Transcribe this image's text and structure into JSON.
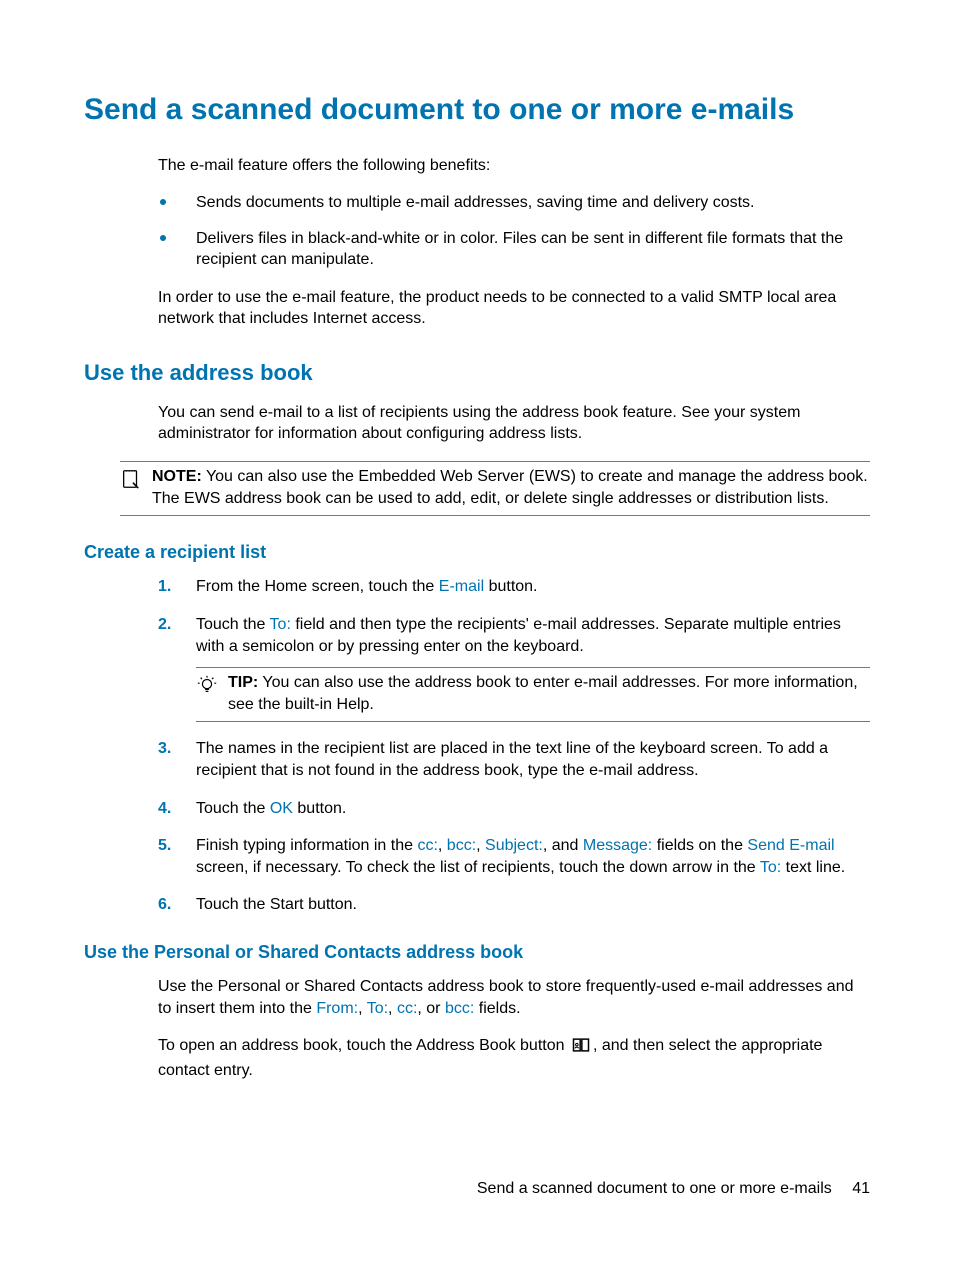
{
  "title": "Send a scanned document to one or more e-mails",
  "intro": "The e-mail feature offers the following benefits:",
  "bullets": [
    "Sends documents to multiple e-mail addresses, saving time and delivery costs.",
    "Delivers files in black-and-white or in color. Files can be sent in different file formats that the recipient can manipulate."
  ],
  "intro2": "In order to use the e-mail feature, the product needs to be connected to a valid SMTP local area network that includes Internet access.",
  "section1": {
    "heading": "Use the address book",
    "para": "You can send e-mail to a list of recipients using the address book feature. See your system administrator for information about configuring address lists.",
    "note_label": "NOTE:",
    "note_text": "You can also use the Embedded Web Server (EWS) to create and manage the address book. The EWS address book can be used to add, edit, or delete single addresses or distribution lists."
  },
  "section2": {
    "heading": "Create a recipient list",
    "steps": {
      "s1a": "From the Home screen, touch the ",
      "s1_ui": "E-mail",
      "s1b": " button.",
      "s2a": "Touch the ",
      "s2_ui": "To:",
      "s2b": " field and then type the recipients' e-mail addresses. Separate multiple entries with a semicolon or by pressing enter on the keyboard.",
      "tip_label": "TIP:",
      "tip_text": "You can also use the address book to enter e-mail addresses. For more information, see the built-in Help.",
      "s3": "The names in the recipient list are placed in the text line of the keyboard screen. To add a recipient that is not found in the address book, type the e-mail address.",
      "s4a": "Touch the ",
      "s4_ui": "OK",
      "s4b": " button.",
      "s5a": "Finish typing information in the ",
      "s5_cc": "cc:",
      "s5_bcc": "bcc:",
      "s5_subject": "Subject:",
      "s5_and": ", and ",
      "s5_message": "Message:",
      "s5b": " fields on the ",
      "s5_send": "Send E-mail",
      "s5c": " screen, if necessary. To check the list of recipients, touch the down arrow in the ",
      "s5_to": "To:",
      "s5d": " text line.",
      "s6": "Touch the Start button."
    }
  },
  "section3": {
    "heading": "Use the Personal or Shared Contacts address book",
    "p1a": "Use the Personal or Shared Contacts address book to store frequently-used e-mail addresses and to insert them into the ",
    "from": "From:",
    "to": "To:",
    "cc": "cc:",
    "or": ", or ",
    "bcc": "bcc:",
    "p1b": " fields.",
    "p2a": "To open an address book, touch the Address Book button ",
    "p2b": ", and then select the appropriate contact entry."
  },
  "footer": {
    "text": "Send a scanned document to one or more e-mails",
    "page": "41"
  },
  "sep_comma": ", "
}
